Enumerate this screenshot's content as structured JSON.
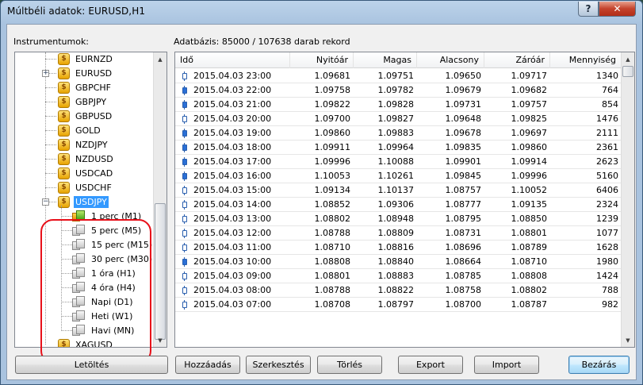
{
  "window": {
    "title": "Múltbéli adatok: EURUSD,H1",
    "help_label": "?",
    "close_label": "✕"
  },
  "labels": {
    "instruments": "Instrumentumok:",
    "database": "Adatbázis: 85000 / 107638 darab rekord"
  },
  "tree": {
    "symbols": [
      {
        "name": "EURNZD",
        "expandable": false
      },
      {
        "name": "EURUSD",
        "expandable": true
      },
      {
        "name": "GBPCHF",
        "expandable": false
      },
      {
        "name": "GBPJPY",
        "expandable": false
      },
      {
        "name": "GBPUSD",
        "expandable": false
      },
      {
        "name": "GOLD",
        "expandable": false
      },
      {
        "name": "NZDJPY",
        "expandable": false
      },
      {
        "name": "NZDUSD",
        "expandable": false
      },
      {
        "name": "USDCAD",
        "expandable": false
      },
      {
        "name": "USDCHF",
        "expandable": false
      },
      {
        "name": "USDJPY",
        "expandable": true,
        "expanded": true,
        "selected": true
      }
    ],
    "periods": [
      {
        "label": "1 perc (M1)",
        "active": true
      },
      {
        "label": "5 perc (M5)",
        "active": false
      },
      {
        "label": "15 perc (M15)",
        "active": false
      },
      {
        "label": "30 perc (M30)",
        "active": false
      },
      {
        "label": "1 óra (H1)",
        "active": false
      },
      {
        "label": "4 óra (H4)",
        "active": false
      },
      {
        "label": "Napi (D1)",
        "active": false
      },
      {
        "label": "Heti (W1)",
        "active": false
      },
      {
        "label": "Havi (MN)",
        "active": false
      }
    ],
    "last_symbol": "XAGUSD",
    "coin_symbol": "$"
  },
  "table": {
    "columns": [
      "Idő",
      "Nyitóár",
      "Magas",
      "Alacsony",
      "Záróár",
      "Mennyiség"
    ],
    "rows": [
      {
        "time": "2015.04.03 23:00",
        "open": "1.09681",
        "high": "1.09751",
        "low": "1.09650",
        "close": "1.09717",
        "volume": "1340",
        "dir": "bull"
      },
      {
        "time": "2015.04.03 22:00",
        "open": "1.09758",
        "high": "1.09782",
        "low": "1.09679",
        "close": "1.09682",
        "volume": "764",
        "dir": "bear"
      },
      {
        "time": "2015.04.03 21:00",
        "open": "1.09822",
        "high": "1.09828",
        "low": "1.09731",
        "close": "1.09757",
        "volume": "854",
        "dir": "bear"
      },
      {
        "time": "2015.04.03 20:00",
        "open": "1.09700",
        "high": "1.09827",
        "low": "1.09648",
        "close": "1.09825",
        "volume": "1476",
        "dir": "bull"
      },
      {
        "time": "2015.04.03 19:00",
        "open": "1.09860",
        "high": "1.09883",
        "low": "1.09678",
        "close": "1.09697",
        "volume": "2111",
        "dir": "bear"
      },
      {
        "time": "2015.04.03 18:00",
        "open": "1.09911",
        "high": "1.09964",
        "low": "1.09835",
        "close": "1.09860",
        "volume": "2361",
        "dir": "bear"
      },
      {
        "time": "2015.04.03 17:00",
        "open": "1.09996",
        "high": "1.10088",
        "low": "1.09901",
        "close": "1.09914",
        "volume": "2623",
        "dir": "bear"
      },
      {
        "time": "2015.04.03 16:00",
        "open": "1.10053",
        "high": "1.10261",
        "low": "1.09845",
        "close": "1.09996",
        "volume": "5160",
        "dir": "bear"
      },
      {
        "time": "2015.04.03 15:00",
        "open": "1.09134",
        "high": "1.10137",
        "low": "1.08757",
        "close": "1.10052",
        "volume": "6406",
        "dir": "bull"
      },
      {
        "time": "2015.04.03 14:00",
        "open": "1.08852",
        "high": "1.09306",
        "low": "1.08777",
        "close": "1.09135",
        "volume": "2324",
        "dir": "bull"
      },
      {
        "time": "2015.04.03 13:00",
        "open": "1.08802",
        "high": "1.08948",
        "low": "1.08795",
        "close": "1.08850",
        "volume": "1239",
        "dir": "bull"
      },
      {
        "time": "2015.04.03 12:00",
        "open": "1.08788",
        "high": "1.08809",
        "low": "1.08731",
        "close": "1.08801",
        "volume": "1077",
        "dir": "bull"
      },
      {
        "time": "2015.04.03 11:00",
        "open": "1.08710",
        "high": "1.08816",
        "low": "1.08696",
        "close": "1.08789",
        "volume": "1628",
        "dir": "bull"
      },
      {
        "time": "2015.04.03 10:00",
        "open": "1.08808",
        "high": "1.08840",
        "low": "1.08664",
        "close": "1.08710",
        "volume": "1980",
        "dir": "bear"
      },
      {
        "time": "2015.04.03 09:00",
        "open": "1.08801",
        "high": "1.08883",
        "low": "1.08785",
        "close": "1.08808",
        "volume": "1424",
        "dir": "bull"
      },
      {
        "time": "2015.04.03 08:00",
        "open": "1.08788",
        "high": "1.08822",
        "low": "1.08758",
        "close": "1.08802",
        "volume": "788",
        "dir": "bull"
      },
      {
        "time": "2015.04.03 07:00",
        "open": "1.08708",
        "high": "1.08797",
        "low": "1.08700",
        "close": "1.08787",
        "volume": "982",
        "dir": "bull"
      }
    ]
  },
  "buttons": {
    "download": "Letöltés",
    "add": "Hozzáadás",
    "edit": "Szerkesztés",
    "delete": "Törlés",
    "export": "Export",
    "import": "Import",
    "close": "Bezárás"
  },
  "colors": {
    "selection": "#3399ff",
    "highlight_ring": "#e8101a",
    "bull_candle": "#ffffff",
    "bear_candle": "#2a6fd6"
  }
}
